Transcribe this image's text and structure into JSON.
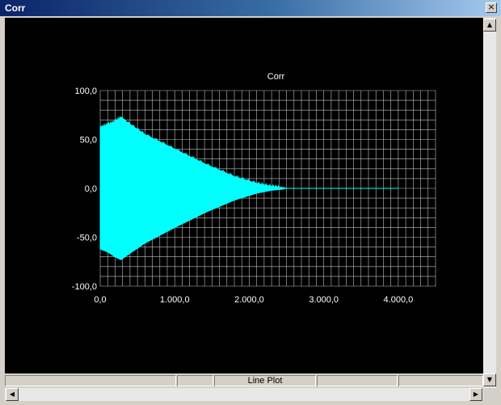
{
  "window": {
    "title": "Corr",
    "close_symbol": "×"
  },
  "statusbar": {
    "panes": [
      "",
      "",
      "Line Plot",
      "",
      ""
    ]
  },
  "chart_data": {
    "type": "line",
    "title": "Corr",
    "xlabel": "",
    "ylabel": "",
    "xlim": [
      0,
      4500
    ],
    "ylim": [
      -100,
      100
    ],
    "x_ticks": [
      0,
      1000,
      2000,
      3000,
      4000
    ],
    "x_tick_labels": [
      "0,0",
      "1.000,0",
      "2.000,0",
      "3.000,0",
      "4.000,0"
    ],
    "y_ticks": [
      100,
      50,
      0,
      -50,
      -100
    ],
    "y_tick_labels": [
      "100,0",
      "50,0",
      "0,0",
      "-50,0",
      "-100,0"
    ],
    "grid": true,
    "colors": {
      "background": "#000000",
      "series": "#00ffff",
      "grid": "#c0c0c0",
      "text": "#ffffff"
    },
    "series": [
      {
        "envelope_upper": [
          [
            0,
            62
          ],
          [
            100,
            65
          ],
          [
            200,
            68
          ],
          [
            280,
            72
          ],
          [
            350,
            68
          ],
          [
            600,
            55
          ],
          [
            1000,
            40
          ],
          [
            1400,
            25
          ],
          [
            1800,
            12
          ],
          [
            2100,
            5
          ],
          [
            2300,
            2
          ],
          [
            2450,
            0.8
          ],
          [
            2500,
            0
          ]
        ],
        "envelope_lower": [
          [
            0,
            -62
          ],
          [
            100,
            -65
          ],
          [
            200,
            -70
          ],
          [
            280,
            -73
          ],
          [
            350,
            -69
          ],
          [
            600,
            -56
          ],
          [
            1000,
            -40
          ],
          [
            1400,
            -25
          ],
          [
            1800,
            -12
          ],
          [
            2100,
            -5
          ],
          [
            2300,
            -2
          ],
          [
            2450,
            -0.8
          ],
          [
            2500,
            0
          ]
        ],
        "tail": [
          [
            2500,
            0
          ],
          [
            4000,
            0
          ]
        ]
      }
    ]
  }
}
